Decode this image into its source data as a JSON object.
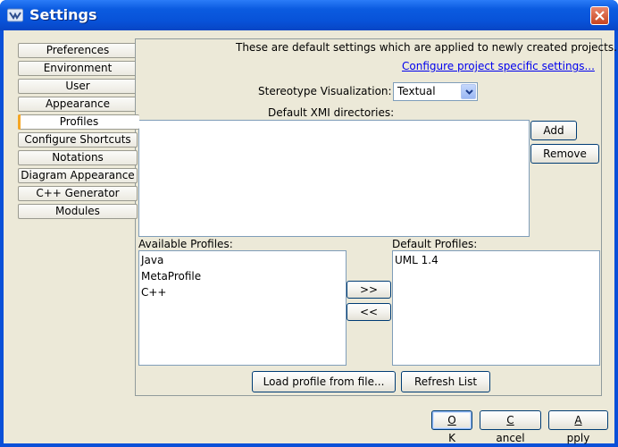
{
  "window": {
    "title": "Settings"
  },
  "nav": {
    "items": [
      {
        "label": "Preferences"
      },
      {
        "label": "Environment"
      },
      {
        "label": "User"
      },
      {
        "label": "Appearance"
      },
      {
        "label": "Profiles",
        "active": true
      },
      {
        "label": "Configure Shortcuts"
      },
      {
        "label": "Notations"
      },
      {
        "label": "Diagram Appearance"
      },
      {
        "label": "C++ Generator"
      },
      {
        "label": "Modules"
      }
    ]
  },
  "profiles": {
    "info_text": "These are default settings which are applied to newly created projects.",
    "configure_link": "Configure project specific settings...",
    "stereotype_label": "Stereotype Visualization:",
    "stereotype_value": "Textual",
    "xmi_label": "Default XMI directories:",
    "add_label": "Add",
    "remove_label": "Remove",
    "available_label": "Available Profiles:",
    "available_items": [
      "Java",
      "MetaProfile",
      "C++"
    ],
    "default_label": "Default Profiles:",
    "default_items": [
      "UML 1.4"
    ],
    "move_right_label": ">>",
    "move_left_label": "<<",
    "load_label": "Load profile from file...",
    "refresh_label": "Refresh List"
  },
  "footer": {
    "ok_label": "OK",
    "ok_mnemonic": "O",
    "ok_rest": "K",
    "cancel_label": "Cancel",
    "cancel_mnemonic": "C",
    "cancel_rest": "ancel",
    "apply_label": "Apply",
    "apply_mnemonic": "A",
    "apply_rest": "pply"
  },
  "colors": {
    "titlebar": "#0852d8",
    "face": "#ece9d8",
    "link": "#0000ee",
    "active_tab_accent": "#f5a623"
  }
}
